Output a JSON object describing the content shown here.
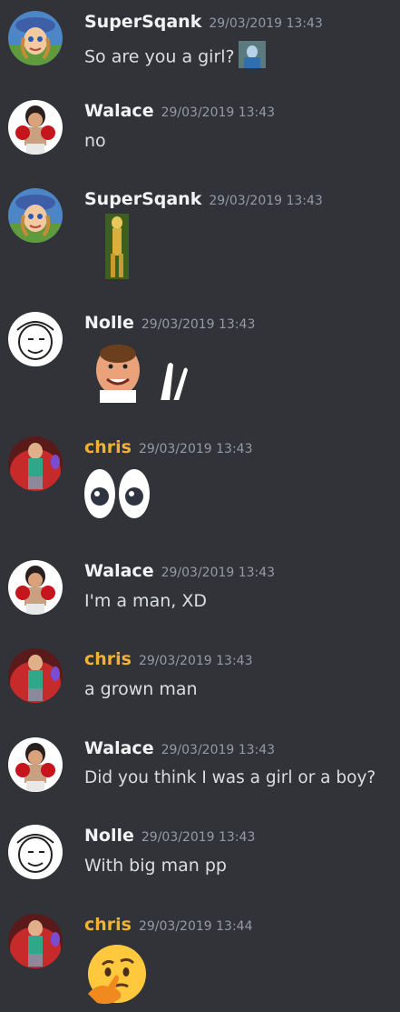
{
  "messages": [
    {
      "author": "SuperSqank",
      "timestamp": "29/03/2019 13:43",
      "text": "So are you a girl?",
      "avatar": "blue-hat-girl-avatar",
      "emoji": "small-image-emoji"
    },
    {
      "author": "Walace",
      "timestamp": "29/03/2019 13:43",
      "text": "no",
      "avatar": "boxer-avatar"
    },
    {
      "author": "SuperSqank",
      "timestamp": "29/03/2019 13:43",
      "text": "",
      "avatar": "blue-hat-girl-avatar",
      "emoji": "tall-yellow-figure-emoji"
    },
    {
      "author": "Nolle",
      "timestamp": "29/03/2019 13:43",
      "text": "",
      "avatar": "sketch-face-avatar",
      "emoji": "laughing-man-and-clap-emoji"
    },
    {
      "author": "chris",
      "timestamp": "29/03/2019 13:43",
      "text": "",
      "avatar": "red-chair-avatar",
      "emoji": "eyes-emoji"
    },
    {
      "author": "Walace",
      "timestamp": "29/03/2019 13:43",
      "text": "I'm a man, XD",
      "avatar": "boxer-avatar"
    },
    {
      "author": "chris",
      "timestamp": "29/03/2019 13:43",
      "text": "a grown man",
      "avatar": "red-chair-avatar"
    },
    {
      "author": "Walace",
      "timestamp": "29/03/2019 13:43",
      "text": "Did you think I was a girl or a boy?",
      "avatar": "boxer-avatar"
    },
    {
      "author": "Nolle",
      "timestamp": "29/03/2019 13:43",
      "text": "With big man pp",
      "avatar": "sketch-face-avatar"
    },
    {
      "author": "chris",
      "timestamp": "29/03/2019 13:44",
      "text": "",
      "avatar": "red-chair-avatar",
      "emoji": "thinking-face-emoji"
    }
  ],
  "colors": {
    "background": "#313338",
    "name": "#f2f3f5",
    "name_role": "#f0b232",
    "timestamp": "#949ba4",
    "text": "#dbdee1"
  }
}
